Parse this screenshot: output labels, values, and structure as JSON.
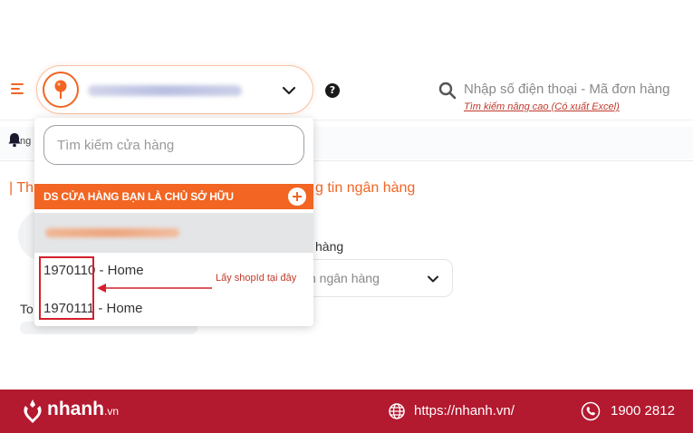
{
  "header": {
    "search_placeholder": "Nhập số điện thoại - Mã đơn hàng",
    "advanced_search": "Tìm kiếm nâng cao (Có xuất Excel)",
    "help_glyph": "?"
  },
  "background": {
    "bell_suffix": "ng",
    "section_title_left": "| Th",
    "section_title_right": "g tin ngân hàng",
    "bank_label": "hàng",
    "bank_select_text": "n ngân hàng",
    "to_label": "To"
  },
  "dropdown": {
    "search_placeholder": "Tìm kiếm cửa hàng",
    "header_label": "DS CỬA HÀNG BẠN LÀ CHỦ SỞ HỮU",
    "stores": [
      {
        "id": "1970110",
        "name": " - Home"
      },
      {
        "id": "1970111",
        "name": " - Home"
      }
    ]
  },
  "annotation": {
    "text": "Lấy shopId tại đây"
  },
  "footer": {
    "logo": "nhanh",
    "logo_suffix": ".vn",
    "website": "https://nhanh.vn/",
    "phone": "1900 2812"
  },
  "colors": {
    "brand_orange": "#f26522",
    "footer_red": "#b3192f",
    "annotation_red": "#d3202b"
  },
  "icons": [
    "menu-icon",
    "location-pin-icon",
    "chevron-down-icon",
    "help-icon",
    "search-icon",
    "bell-icon",
    "add-icon",
    "globe-icon",
    "phone-icon"
  ]
}
